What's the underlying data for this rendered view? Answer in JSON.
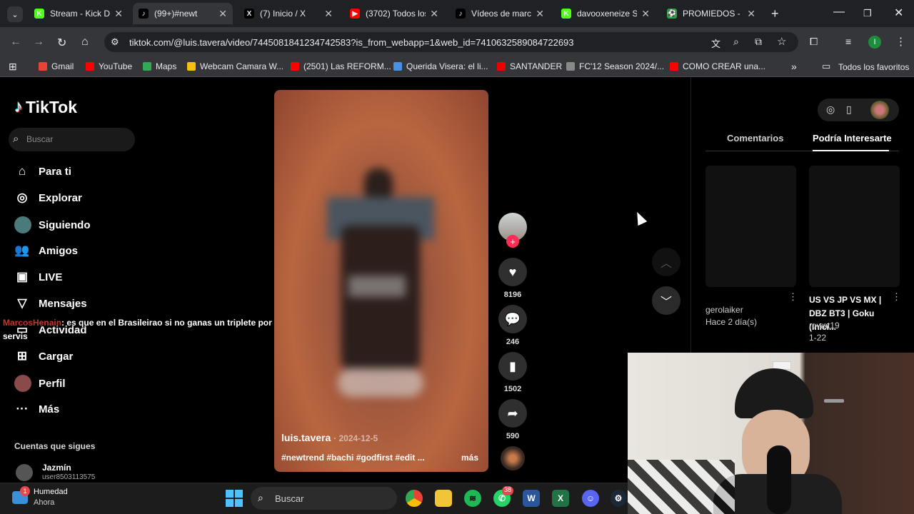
{
  "browser": {
    "tabs": [
      {
        "title": "Stream - Kick Da",
        "fav_color": "#53fc18",
        "fav_glyph": "K"
      },
      {
        "title": "(99+)#newt",
        "fav_color": "#000000",
        "fav_glyph": "♪"
      },
      {
        "title": "(7) Inicio / X",
        "fav_color": "#000000",
        "fav_glyph": "X"
      },
      {
        "title": "(3702) Todos los",
        "fav_color": "#ff0000",
        "fav_glyph": "▶"
      },
      {
        "title": "Vídeos de marcl",
        "fav_color": "#000000",
        "fav_glyph": "♪"
      },
      {
        "title": "davooxeneize St",
        "fav_color": "#53fc18",
        "fav_glyph": "K"
      },
      {
        "title": "PROMIEDOS - F",
        "fav_color": "#2ea043",
        "fav_glyph": "⚽"
      }
    ],
    "new_tab_label": "+",
    "url": "tiktok.com/@luis.tavera/video/7445081841234742583?is_from_webapp=1&web_id=7410632589084722693",
    "profile_initial": "I",
    "bookmarks": [
      {
        "label": "Gmail",
        "color": "#ea4335"
      },
      {
        "label": "YouTube",
        "color": "#ff0000"
      },
      {
        "label": "Maps",
        "color": "#34a853"
      },
      {
        "label": "Webcam Camara W...",
        "color": "#f4c20d"
      },
      {
        "label": "(2501) Las REFORM...",
        "color": "#ff0000"
      },
      {
        "label": "Querida Visera: el li...",
        "color": "#4a90e2"
      },
      {
        "label": "SANTANDER",
        "color": "#ec0000"
      },
      {
        "label": "FC'12 Season 2024/...",
        "color": "#888888"
      },
      {
        "label": "COMO CREAR una...",
        "color": "#ff0000"
      }
    ],
    "bookmarks_more": "»",
    "all_favorites": "Todos los favoritos"
  },
  "tiktok": {
    "brand": "TikTok",
    "search_placeholder": "Buscar",
    "nav": [
      {
        "label": "Para ti",
        "icon": "home-icon",
        "glyph": "⌂"
      },
      {
        "label": "Explorar",
        "icon": "compass-icon",
        "glyph": "◎"
      },
      {
        "label": "Siguiendo",
        "icon": "following-avatar-icon",
        "glyph": "●"
      },
      {
        "label": "Amigos",
        "icon": "friends-icon",
        "glyph": "👥"
      },
      {
        "label": "LIVE",
        "icon": "live-icon",
        "glyph": "▣"
      },
      {
        "label": "Mensajes",
        "icon": "messages-icon",
        "glyph": "▽"
      },
      {
        "label": "Actividad",
        "icon": "activity-icon",
        "glyph": "▭"
      },
      {
        "label": "Cargar",
        "icon": "upload-icon",
        "glyph": "⊞"
      },
      {
        "label": "Perfil",
        "icon": "profile-icon",
        "glyph": "●"
      },
      {
        "label": "Más",
        "icon": "more-icon",
        "glyph": "···"
      }
    ],
    "following_heading": "Cuentas que sigues",
    "following_account": {
      "name": "Jazmín",
      "handle": "user8503113575"
    },
    "video": {
      "author": "luis.tavera",
      "date": "· 2024-12-5",
      "caption": "#newtrend #bachi #godfirst #edit ...",
      "more": "más"
    },
    "actions": {
      "likes": "8196",
      "comments": "246",
      "saves": "1502",
      "shares": "590"
    },
    "right_panel": {
      "tab_comments": "Comentarios",
      "tab_interest": "Podría Interesarte",
      "cards": [
        {
          "title": "",
          "author": "gerolaiker",
          "meta": "Hace 2 día(s)"
        },
        {
          "title": "US VS JP VS MX | DBZ BT3 | Goku (Inici...",
          "author": "rowat19",
          "meta": "1-22"
        }
      ]
    }
  },
  "chat_overlay": {
    "user": "MarcosHenain",
    "message": ": es que en el Brasileirao si no ganas un triplete por año no",
    "continuation": "servis"
  },
  "taskbar": {
    "notification_title": "Humedad",
    "notification_sub": "Ahora",
    "notification_badge": "1",
    "search_placeholder": "Buscar",
    "whatsapp_badge": "38"
  }
}
